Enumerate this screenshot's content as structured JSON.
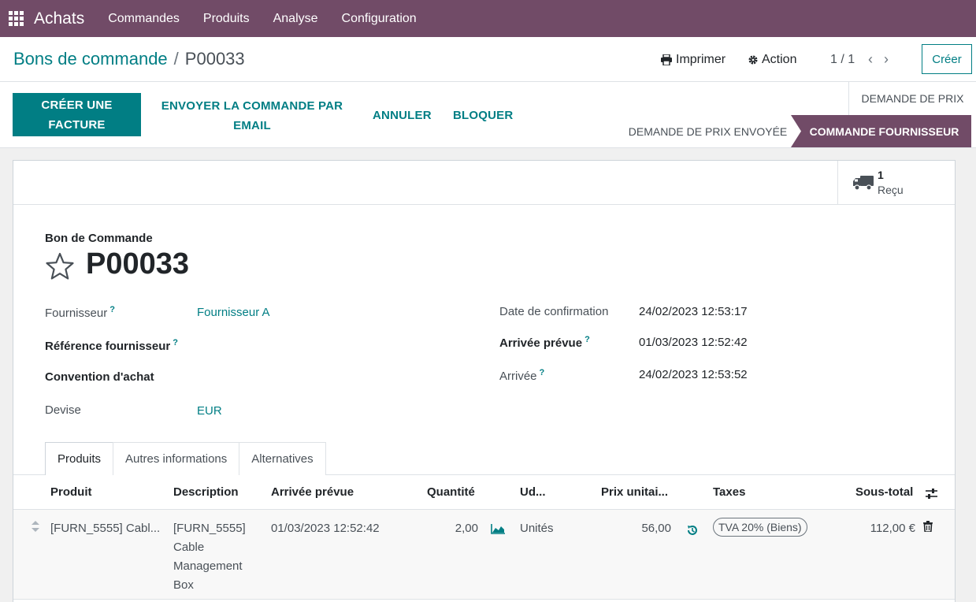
{
  "navbar": {
    "app_name": "Achats",
    "menu": [
      "Commandes",
      "Produits",
      "Analyse",
      "Configuration"
    ]
  },
  "control_panel": {
    "breadcrumb_parent": "Bons de commande",
    "breadcrumb_sep": "/",
    "breadcrumb_current": "P00033",
    "print_label": "Imprimer",
    "action_label": "Action",
    "pager": "1 / 1",
    "create_label": "Créer"
  },
  "statusbar": {
    "buttons": {
      "create_invoice": "CRÉER UNE FACTURE",
      "send_email": "ENVOYER LA COMMANDE PAR EMAIL",
      "cancel": "ANNULER",
      "block": "BLOQUER"
    },
    "stages": {
      "quotation": "DEMANDE DE PRIX",
      "quotation_sent": "DEMANDE DE PRIX ENVOYÉE",
      "purchase_order": "COMMANDE FOURNISSEUR"
    }
  },
  "smart_button": {
    "value": "1",
    "label": "Reçu"
  },
  "form": {
    "title_label": "Bon de Commande",
    "record_name": "P00033",
    "help_mark": "?",
    "left": {
      "vendor_label": "Fournisseur",
      "vendor_value": "Fournisseur A",
      "vendor_ref_label": "Référence fournisseur",
      "agreement_label": "Convention d'achat",
      "currency_label": "Devise",
      "currency_value": "EUR"
    },
    "right": {
      "confirm_date_label": "Date de confirmation",
      "confirm_date_value": "24/02/2023 12:53:17",
      "expected_label": "Arrivée prévue",
      "expected_value": "01/03/2023 12:52:42",
      "arrival_label": "Arrivée",
      "arrival_value": "24/02/2023 12:53:52"
    }
  },
  "tabs": [
    "Produits",
    "Autres informations",
    "Alternatives"
  ],
  "table": {
    "headers": {
      "product": "Produit",
      "description": "Description",
      "expected": "Arrivée prévue",
      "quantity": "Quantité",
      "uom": "Ud...",
      "price": "Prix unitai...",
      "taxes": "Taxes",
      "subtotal": "Sous-total"
    },
    "rows": [
      {
        "product": "[FURN_5555] Cabl...",
        "description_lines": [
          "[FURN_5555]",
          "Cable",
          "Management",
          "Box"
        ],
        "expected": "01/03/2023 12:52:42",
        "quantity": "2,00",
        "uom": "Unités",
        "price": "56,00",
        "tax": "TVA 20% (Biens)",
        "subtotal": "112,00 €"
      }
    ]
  },
  "colors": {
    "brand": "#714b67",
    "accent": "#017e84"
  }
}
